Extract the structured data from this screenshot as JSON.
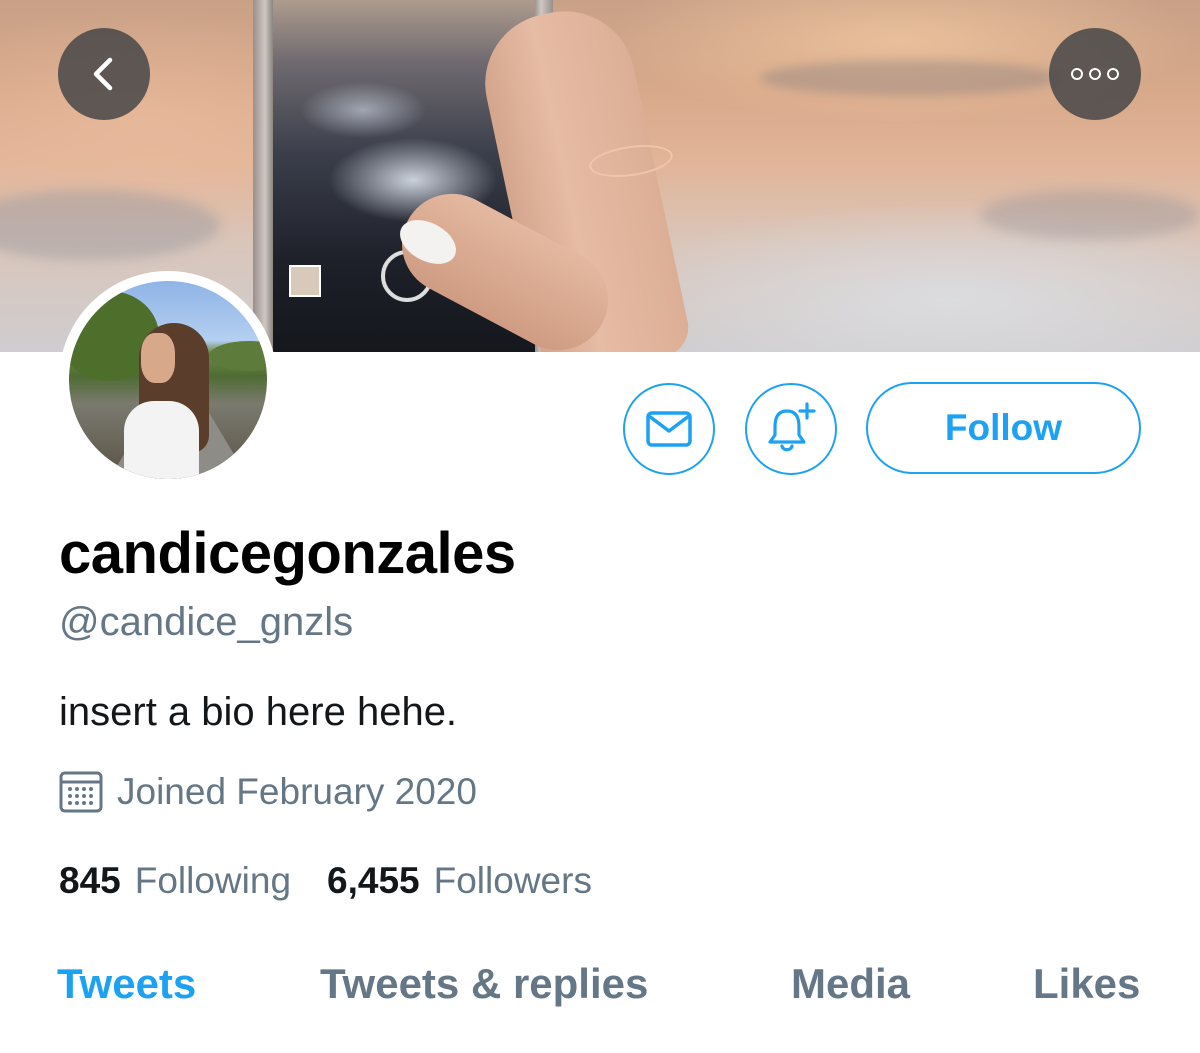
{
  "header": {
    "back_icon": "chevron-left-icon",
    "more_icon": "more-horizontal-icon"
  },
  "actions": {
    "message_icon": "envelope-icon",
    "notify_icon": "bell-plus-icon",
    "follow_label": "Follow"
  },
  "profile": {
    "display_name": "candicegonzales",
    "handle": "@candice_gnzls",
    "bio": "insert a bio here hehe.",
    "joined": "Joined February 2020",
    "joined_icon": "calendar-icon"
  },
  "stats": {
    "following_count": "845",
    "following_label": "Following",
    "followers_count": "6,455",
    "followers_label": "Followers"
  },
  "tabs": [
    {
      "label": "Tweets",
      "active": true
    },
    {
      "label": "Tweets & replies",
      "active": false
    },
    {
      "label": "Media",
      "active": false
    },
    {
      "label": "Likes",
      "active": false
    }
  ],
  "colors": {
    "accent": "#1da1f2",
    "secondary_text": "#657786",
    "primary_text": "#14171a"
  }
}
